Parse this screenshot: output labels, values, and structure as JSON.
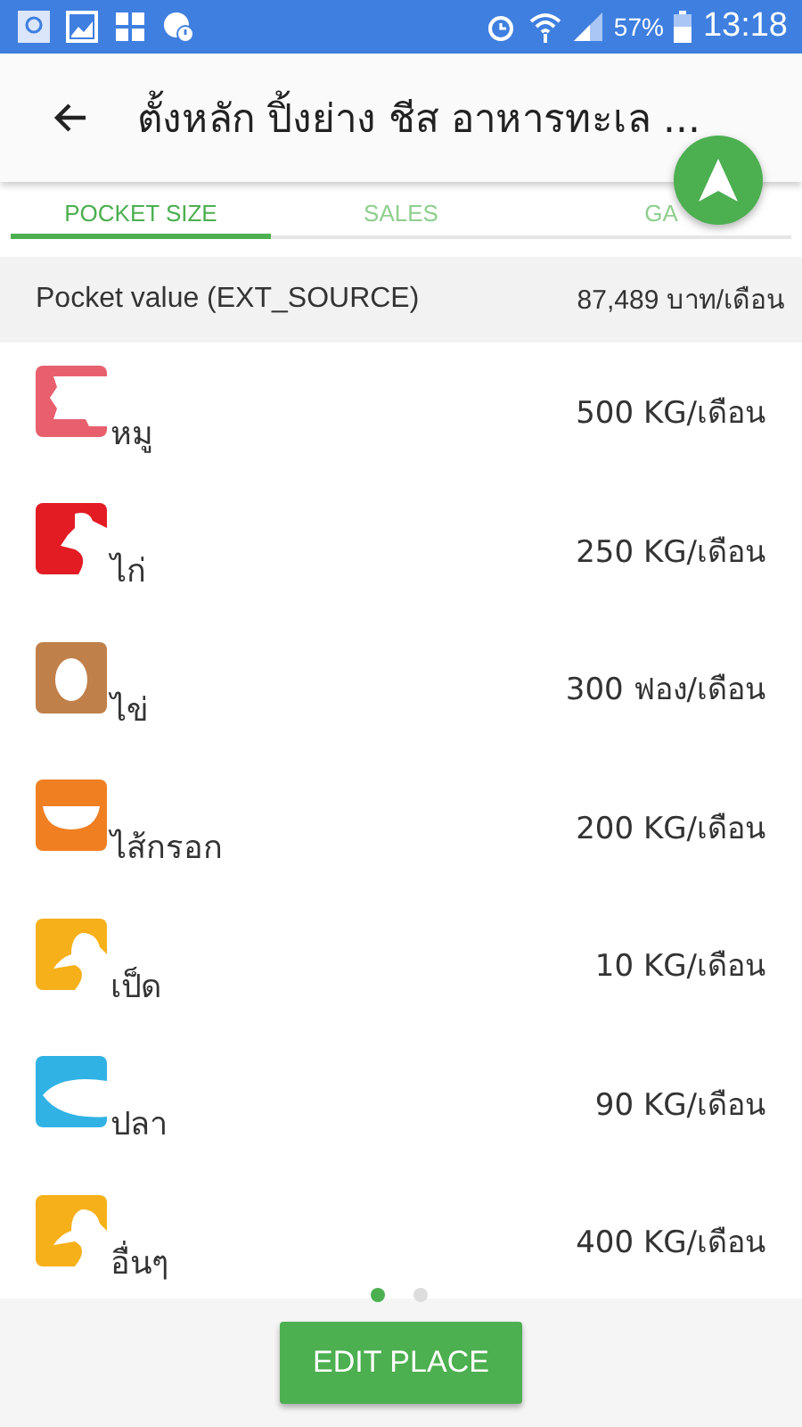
{
  "status_bar": {
    "battery": "57%",
    "time": "13:18"
  },
  "toolbar": {
    "title": "ตั้งหลัก ปิ้งย่าง ชีส อาหารทะเล ..."
  },
  "tabs": [
    {
      "label": "POCKET SIZE",
      "selected": true
    },
    {
      "label": "SALES",
      "selected": false
    },
    {
      "label": "GA",
      "selected": false
    }
  ],
  "pocket_value": {
    "label": "Pocket value (EXT_SOURCE)",
    "value": "87,489 บาท/เดือน"
  },
  "items": [
    {
      "kind": "pig",
      "name": "หมู",
      "amount": "500 KG/เดือน",
      "color": "#e8606e"
    },
    {
      "kind": "chicken",
      "name": "ไก่",
      "amount": "250 KG/เดือน",
      "color": "#e31b23"
    },
    {
      "kind": "egg",
      "name": "ไข่",
      "amount": "300 ฟอง/เดือน",
      "color": "#c0804a"
    },
    {
      "kind": "sausage",
      "name": "ไส้กรอก",
      "amount": "200 KG/เดือน",
      "color": "#f07f22"
    },
    {
      "kind": "duck",
      "name": "เป็ด",
      "amount": "10 KG/เดือน",
      "color": "#f6b01a"
    },
    {
      "kind": "fish",
      "name": "ปลา",
      "amount": "90 KG/เดือน",
      "color": "#31b2e5"
    },
    {
      "kind": "duck",
      "name": "อื่นๆ",
      "amount": "400 KG/เดือน",
      "color": "#f6b01a"
    }
  ],
  "pages": [
    {
      "selected": true
    },
    {
      "selected": false
    }
  ],
  "button": "EDIT PLACE"
}
